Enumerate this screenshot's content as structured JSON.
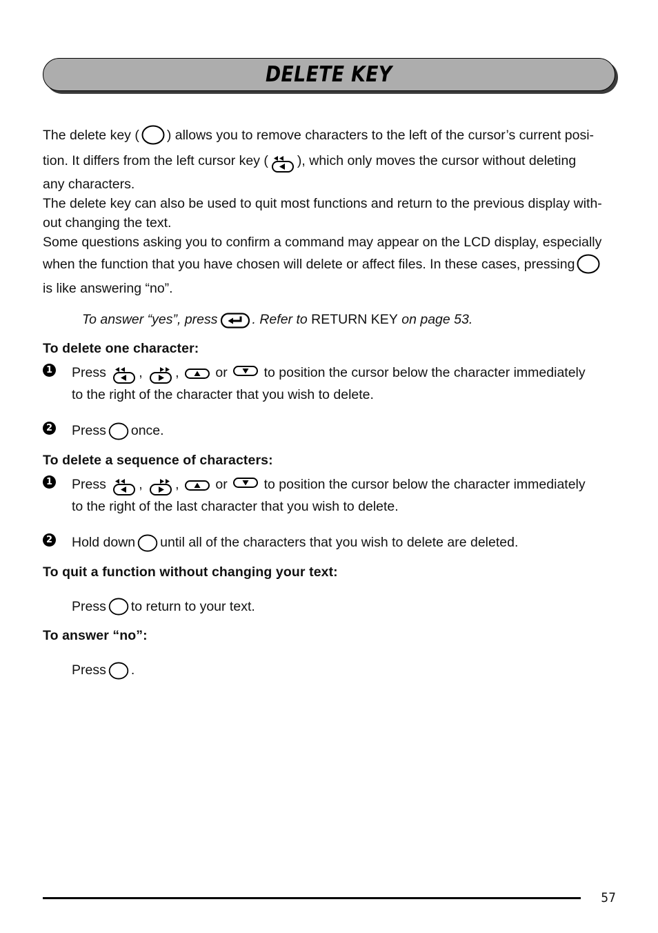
{
  "page": {
    "title": "DELETE KEY",
    "page_number": "57",
    "banner_color": "#adadad",
    "text_color": "#000000"
  },
  "intro": {
    "line1_a": "The delete key (",
    "line1_b": ") allows you to remove characters to the left of the cursor’s current posi-",
    "line2_a": "tion. It differs from the left cursor key (",
    "line2_b": "), which only moves the cursor without deleting",
    "line3": "any characters.",
    "para2_line1": "The delete key can also be used to quit most functions and return to the previous display with-",
    "para2_line2": "out changing the text.",
    "para3_line1": "Some questions asking you to confirm a command may appear on the LCD display, especially",
    "para3_line2_a": "when the function that you have chosen will delete or affect files. In these cases, pressing",
    "para3_line3": "is like answering “no”."
  },
  "note": {
    "a": "To answer “yes”, press",
    "b": ". Refer to ",
    "c": "RETURN KEY",
    "d": " on page 53."
  },
  "sections": [
    {
      "heading": "To delete one character:",
      "steps": [
        {
          "number": "❶",
          "text_a": "Press",
          "text_or": "or",
          "text_b": "to position the cursor below the character immediately",
          "text_c": "to the right of the character that you wish to delete."
        },
        {
          "number": "❷",
          "text_a": "Press",
          "text_b": "once."
        }
      ]
    },
    {
      "heading": "To delete a sequence of characters:",
      "steps": [
        {
          "number": "❶",
          "text_a": "Press",
          "text_or": "or",
          "text_b": "to position the cursor below the character immediately",
          "text_c": "to the right of the last character that you wish to delete."
        },
        {
          "number": "❷",
          "text_a": "Hold down",
          "text_b": "until all of the characters that you wish to delete are deleted."
        }
      ]
    },
    {
      "heading": "To quit a function without changing your text:",
      "press": {
        "text_a": "Press",
        "text_b": "to return to your text."
      }
    },
    {
      "heading": "To answer “no”:",
      "press": {
        "text_a": "Press",
        "text_b": "."
      }
    }
  ],
  "icons": {
    "delete_key": "delete-key-icon",
    "return_key": "return-key-icon",
    "left_cursor_key": "left-cursor-key-icon",
    "right_cursor_key": "right-cursor-key-icon",
    "up_cursor_key": "up-cursor-key-icon",
    "down_cursor_key": "down-cursor-key-icon"
  }
}
